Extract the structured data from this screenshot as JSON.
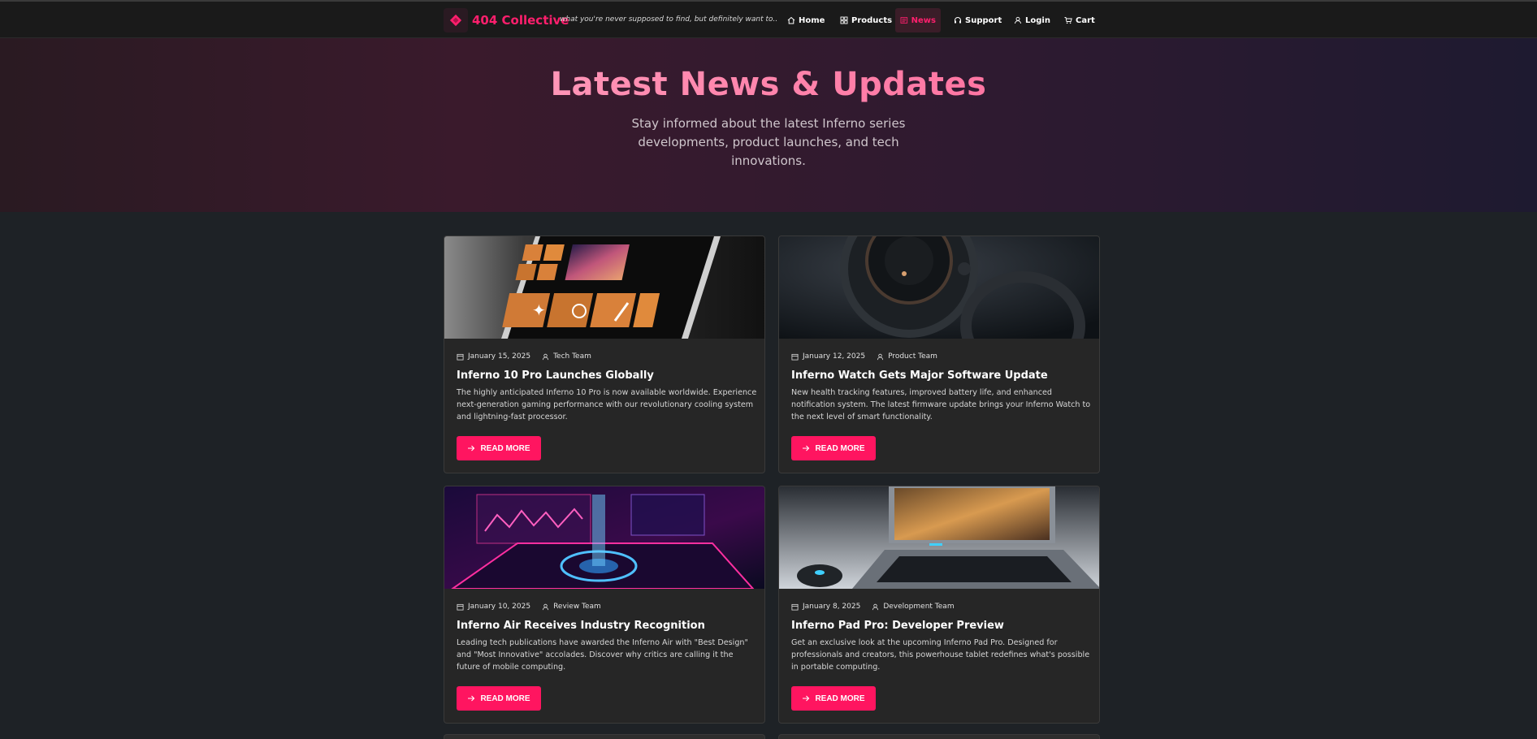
{
  "brand": {
    "name": "404 Collective",
    "tagline": "what you're never supposed to find, but definitely want to.."
  },
  "nav": {
    "items": [
      {
        "label": "Home",
        "icon": "home-icon"
      },
      {
        "label": "Products",
        "icon": "grid-icon"
      },
      {
        "label": "News",
        "icon": "newspaper-icon",
        "active": true
      },
      {
        "label": "Support",
        "icon": "headset-icon"
      },
      {
        "label": "Login",
        "icon": "user-icon"
      },
      {
        "label": "Cart",
        "icon": "cart-icon"
      }
    ]
  },
  "hero": {
    "title": "Latest News & Updates",
    "subtitle": "Stay informed about the latest Inferno series developments, product launches, and tech innovations."
  },
  "articles": [
    {
      "date": "January 15, 2025",
      "author": "Tech Team",
      "title": "Inferno 10 Pro Launches Globally",
      "description": "The highly anticipated Inferno 10 Pro is now available worldwide. Experience next-generation gaming performance with our revolutionary cooling system and lightning-fast processor.",
      "button": "READ MORE",
      "image": "phone-tiles-image"
    },
    {
      "date": "January 12, 2025",
      "author": "Product Team",
      "title": "Inferno Watch Gets Major Software Update",
      "description": "New health tracking features, improved battery life, and enhanced notification system. The latest firmware update brings your Inferno Watch to the next level of smart functionality.",
      "button": "READ MORE",
      "image": "watch-image"
    },
    {
      "date": "January 10, 2025",
      "author": "Review Team",
      "title": "Inferno Air Receives Industry Recognition",
      "description": "Leading tech publications have awarded the Inferno Air with \"Best Design\" and \"Most Innovative\" accolades. Discover why critics are calling it the future of mobile computing.",
      "button": "READ MORE",
      "image": "holographic-phone-image"
    },
    {
      "date": "January 8, 2025",
      "author": "Development Team",
      "title": "Inferno Pad Pro: Developer Preview",
      "description": "Get an exclusive look at the upcoming Inferno Pad Pro. Designed for professionals and creators, this powerhouse tablet redefines what's possible in portable computing.",
      "button": "READ MORE",
      "image": "gaming-laptop-image"
    }
  ],
  "colors": {
    "accent": "#ff1560",
    "background": "#1e2226",
    "card": "#262626",
    "navbar": "#1a1a1a"
  }
}
